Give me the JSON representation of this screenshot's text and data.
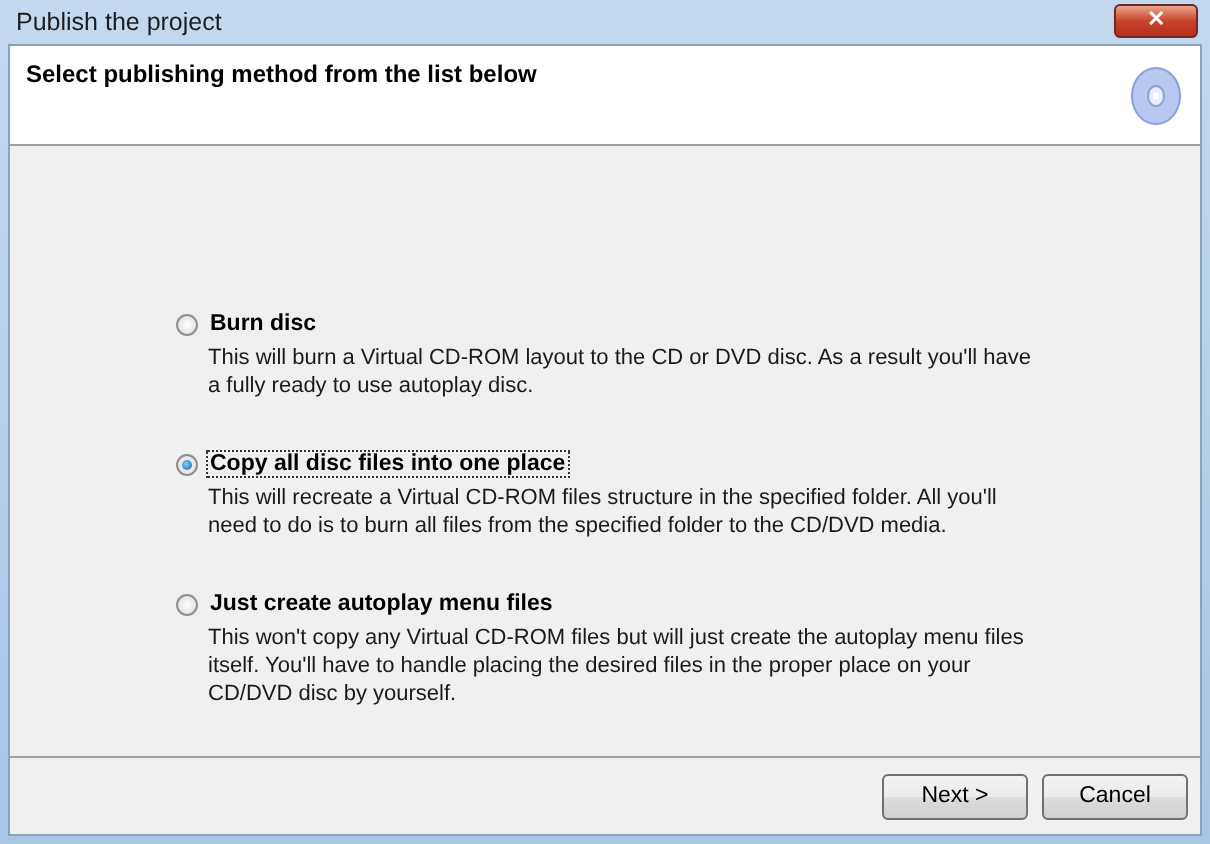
{
  "window": {
    "title": "Publish the project",
    "close": "✕"
  },
  "header": {
    "title": "Select publishing method from the list below"
  },
  "options": [
    {
      "label": "Burn disc",
      "description": "This will burn a Virtual CD-ROM layout to the CD or DVD disc. As a result you'll have a fully ready to use autoplay disc.",
      "selected": false
    },
    {
      "label": "Copy all disc files into one place",
      "description": "This will recreate a Virtual CD-ROM files structure in the specified folder. All you'll need to do is to burn all files from the specified folder to the CD/DVD media.",
      "selected": true
    },
    {
      "label": "Just create autoplay menu files",
      "description": "This won't copy any Virtual CD-ROM files but will just create the autoplay menu files itself. You'll have to handle placing the desired files in the proper place on your CD/DVD disc by yourself.",
      "selected": false
    }
  ],
  "buttons": [
    "Next >",
    "Cancel"
  ]
}
